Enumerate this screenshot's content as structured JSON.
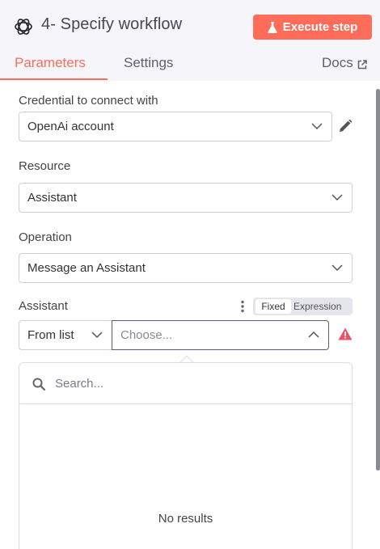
{
  "header": {
    "title": "4- Specify workflow",
    "execute_label": "Execute step",
    "tabs": [
      {
        "label": "Parameters",
        "active": true
      },
      {
        "label": "Settings",
        "active": false
      }
    ],
    "docs_label": "Docs"
  },
  "form": {
    "credential": {
      "label": "Credential to connect with",
      "value": "OpenAi account"
    },
    "resource": {
      "label": "Resource",
      "value": "Assistant"
    },
    "operation": {
      "label": "Operation",
      "value": "Message an Assistant"
    },
    "assistant": {
      "label": "Assistant",
      "mode_value": "From list",
      "placeholder": "Choose...",
      "toggle": {
        "fixed": "Fixed",
        "expression": "Expression"
      }
    }
  },
  "dropdown": {
    "search_placeholder": "Search...",
    "empty_text": "No results"
  },
  "colors": {
    "accent": "#ff6d5a",
    "warning": "#e8536a",
    "header_bg": "#f6f6fa"
  },
  "icons": [
    "openai-logo-icon",
    "flask-icon",
    "external-link-icon",
    "chevron-down-icon",
    "pencil-icon",
    "kebab-menu-icon",
    "chevron-up-icon",
    "warning-icon",
    "search-icon"
  ]
}
